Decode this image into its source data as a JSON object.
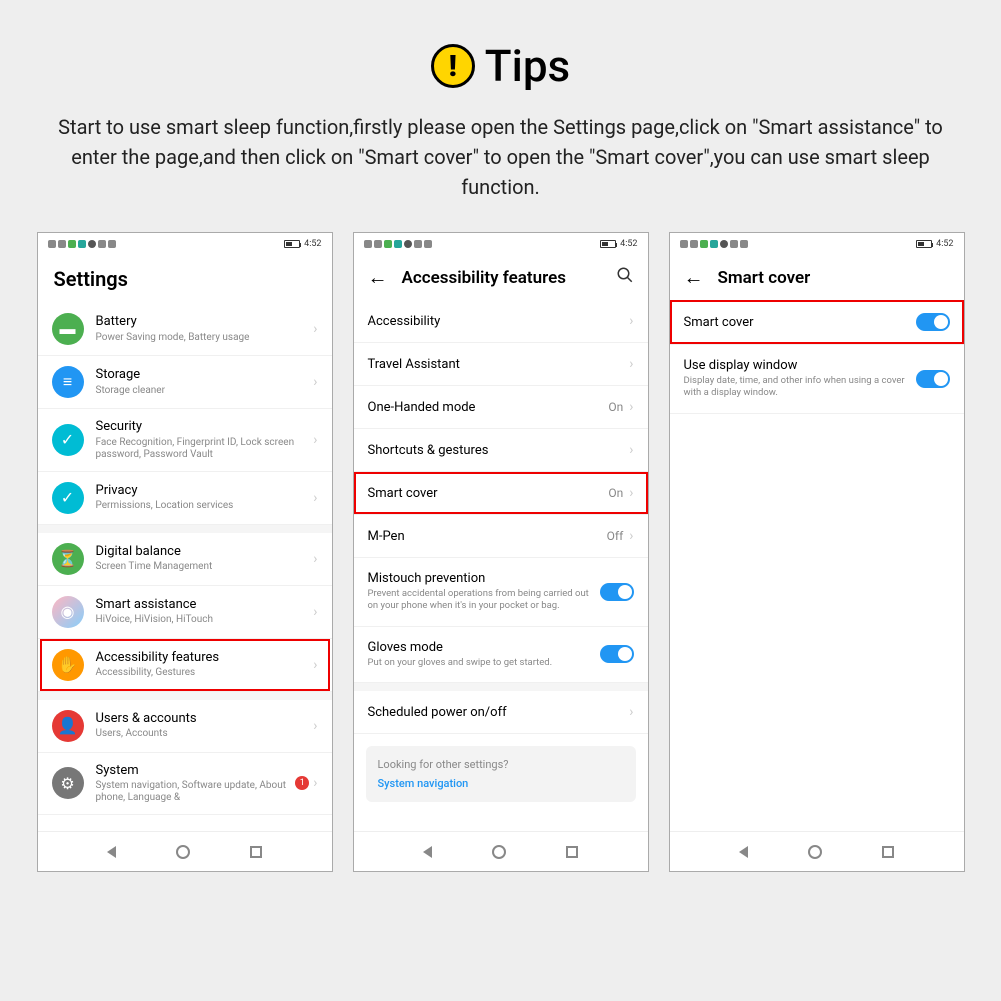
{
  "header": {
    "title": "Tips",
    "description": "Start to use smart sleep function,firstly please open the Settings page,click on \"Smart assistance\" to enter the page,and then click on \"Smart cover\" to open the \"Smart cover\",you can use smart sleep function."
  },
  "status": {
    "time": "4:52"
  },
  "phone1": {
    "title": "Settings",
    "items": [
      {
        "title": "Battery",
        "sub": "Power Saving mode, Battery usage",
        "color": "#4caf50"
      },
      {
        "title": "Storage",
        "sub": "Storage cleaner",
        "color": "#2196f3"
      },
      {
        "title": "Security",
        "sub": "Face Recognition, Fingerprint ID, Lock screen password, Password Vault",
        "color": "#00bcd4"
      },
      {
        "title": "Privacy",
        "sub": "Permissions, Location services",
        "color": "#00bcd4"
      },
      {
        "title": "Digital balance",
        "sub": "Screen Time Management",
        "color": "#4caf50"
      },
      {
        "title": "Smart assistance",
        "sub": "HiVoice, HiVision, HiTouch",
        "color": "linear-gradient(135deg,#ffb6c1,#87cefa)"
      },
      {
        "title": "Accessibility features",
        "sub": "Accessibility, Gestures",
        "color": "#ff9800"
      },
      {
        "title": "Users & accounts",
        "sub": "Users, Accounts",
        "color": "#e53935"
      },
      {
        "title": "System",
        "sub": "System navigation, Software update, About phone, Language &",
        "color": "#777",
        "badge": "1"
      }
    ]
  },
  "phone2": {
    "title": "Accessibility features",
    "items": [
      {
        "title": "Accessibility"
      },
      {
        "title": "Travel Assistant"
      },
      {
        "title": "One-Handed mode",
        "value": "On"
      },
      {
        "title": "Shortcuts & gestures"
      },
      {
        "title": "Smart cover",
        "value": "On",
        "highlight": true
      },
      {
        "title": "M-Pen",
        "value": "Off"
      },
      {
        "title": "Mistouch prevention",
        "sub": "Prevent accidental operations from being carried out on your phone when it's in your pocket or bag.",
        "toggle": true
      },
      {
        "title": "Gloves mode",
        "sub": "Put on your gloves and swipe to get started.",
        "toggle": true
      },
      {
        "title": "Scheduled power on/off"
      }
    ],
    "hint": {
      "q": "Looking for other settings?",
      "link": "System navigation"
    }
  },
  "phone3": {
    "title": "Smart cover",
    "items": [
      {
        "title": "Smart cover",
        "toggle": true,
        "highlight": true
      },
      {
        "title": "Use display window",
        "sub": "Display date, time, and other info when using a cover with a display window.",
        "toggle": true
      }
    ]
  }
}
